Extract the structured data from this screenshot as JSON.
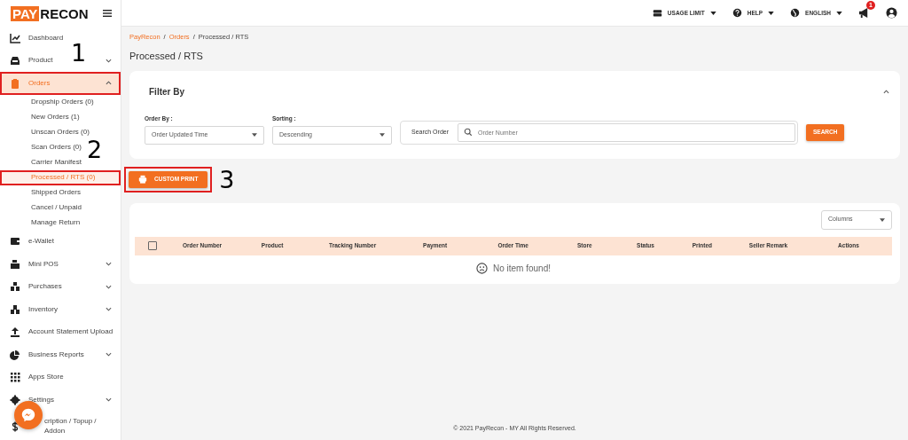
{
  "brand": {
    "first": "PAY",
    "second": "RECON"
  },
  "topbar": {
    "menus": [
      {
        "label": "USAGE LIMIT"
      },
      {
        "label": "HELP"
      },
      {
        "label": "ENGLISH"
      }
    ],
    "notification_count": "1"
  },
  "sidebar": {
    "items": [
      {
        "label": "Dashboard",
        "selected": false,
        "highlighted": false
      },
      {
        "label": "Product",
        "expanded": false,
        "selected": false,
        "highlighted": false
      },
      {
        "label": "Orders",
        "expanded": true,
        "selected": true,
        "highlighted": true,
        "callout": "1",
        "children": [
          {
            "label": "Dropship Orders (0)",
            "selected": false,
            "highlighted": false
          },
          {
            "label": "New Orders (1)",
            "selected": false,
            "highlighted": false
          },
          {
            "label": "Unscan Orders (0)",
            "selected": false,
            "highlighted": false
          },
          {
            "label": "Scan Orders (0)",
            "selected": false,
            "highlighted": false
          },
          {
            "label": "Carrier Manifest",
            "selected": false,
            "highlighted": false
          },
          {
            "label": "Processed / RTS (0)",
            "selected": true,
            "highlighted": true,
            "callout": "2"
          },
          {
            "label": "Shipped Orders",
            "selected": false,
            "highlighted": false
          },
          {
            "label": "Cancel / Unpaid",
            "selected": false,
            "highlighted": false
          },
          {
            "label": "Manage Return",
            "selected": false,
            "highlighted": false
          }
        ]
      },
      {
        "label": "e-Wallet",
        "selected": false,
        "highlighted": false
      },
      {
        "label": "Mini POS",
        "expanded": false,
        "selected": false,
        "highlighted": false
      },
      {
        "label": "Purchases",
        "expanded": false,
        "selected": false,
        "highlighted": false
      },
      {
        "label": "Inventory",
        "expanded": false,
        "selected": false,
        "highlighted": false
      },
      {
        "label": "Account Statement Upload",
        "selected": false,
        "highlighted": false
      },
      {
        "label": "Business Reports",
        "expanded": false,
        "selected": false,
        "highlighted": false
      },
      {
        "label": "Apps Store",
        "selected": false,
        "highlighted": false
      },
      {
        "label": "Settings",
        "expanded": false,
        "selected": false,
        "highlighted": false
      },
      {
        "label": "cription / Topup / Addon",
        "selected": false,
        "highlighted": false
      }
    ]
  },
  "breadcrumb": {
    "separator": "/",
    "items": [
      "PayRecon",
      "Orders",
      "Processed / RTS"
    ]
  },
  "page_title": "Processed / RTS",
  "filter": {
    "title": "Filter By",
    "expanded": true,
    "order_by": {
      "label": "Order By :",
      "value": "Order Updated Time"
    },
    "sorting": {
      "label": "Sorting :",
      "value": "Descending"
    },
    "search": {
      "label": "Search Order",
      "placeholder": "Order Number",
      "button": "SEARCH"
    }
  },
  "custom_print": {
    "label": "CUSTOM PRINT",
    "highlighted": true,
    "callout": "3"
  },
  "table": {
    "columns_button": "Columns",
    "select_all": false,
    "columns": [
      "Order Number",
      "Product",
      "Tracking Number",
      "Payment",
      "Order Time",
      "Store",
      "Status",
      "Printed",
      "Seller Remark",
      "Actions"
    ],
    "empty_message": "No item found!"
  },
  "footer": "© 2021 PayRecon - MY All Rights Reserved."
}
